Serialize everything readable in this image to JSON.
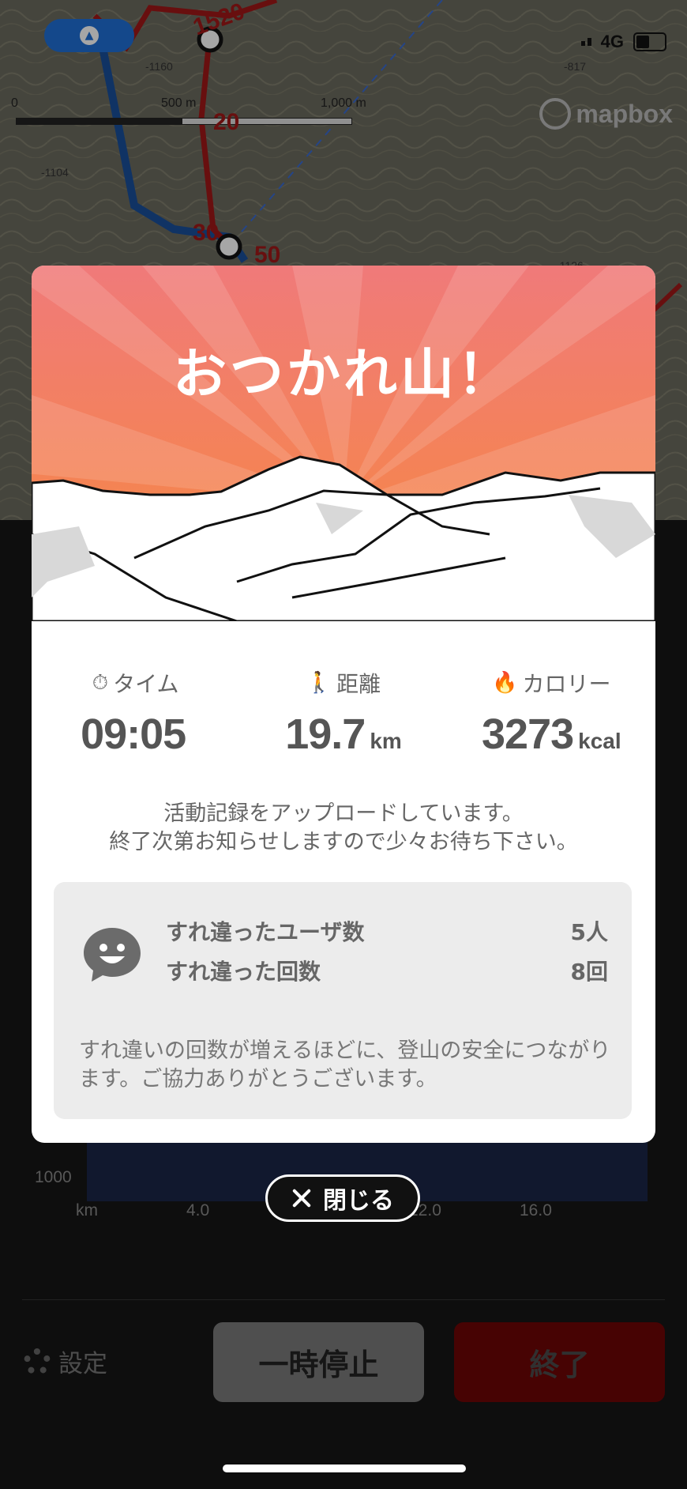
{
  "status": {
    "network": "4G"
  },
  "map": {
    "scale_labels": [
      "0",
      "500 m",
      "1,000 m"
    ],
    "attribution": "mapbox",
    "elevations": [
      "-1160",
      "-1104",
      "-817",
      "-1126"
    ],
    "route_labels": [
      "1520",
      "20",
      "30",
      "50"
    ]
  },
  "modal": {
    "title": "おつかれ山！",
    "stats": [
      {
        "label": "タイム",
        "icon": "stopwatch-icon",
        "value": "09:05",
        "unit": ""
      },
      {
        "label": "距離",
        "icon": "walking-person-icon",
        "value": "19.7",
        "unit": "km"
      },
      {
        "label": "カロリー",
        "icon": "flame-icon",
        "value": "3273",
        "unit": "kcal"
      }
    ],
    "message_line1": "活動記録をアップロードしています。",
    "message_line2": "終了次第お知らせしますので少々お待ち下さい。",
    "encounter": {
      "rows": [
        {
          "label": "すれ違ったユーザ数",
          "value": "5人"
        },
        {
          "label": "すれ違った回数",
          "value": "8回"
        }
      ],
      "note": "すれ違いの回数が増えるほどに、登山の安全につながります。ご協力ありがとうございます。"
    },
    "close_label": "閉じる"
  },
  "chart": {
    "y_label": "1000",
    "x_ticks": [
      "km",
      "4.0",
      "12.0",
      "16.0"
    ]
  },
  "controls": {
    "settings_label": "設定",
    "pause_label": "一時停止",
    "end_label": "終了"
  },
  "colors": {
    "hero_top": "#f07a7a",
    "hero_bottom": "#f7893d",
    "end_button": "#6e0505",
    "location_pill": "#1f6fd6"
  }
}
